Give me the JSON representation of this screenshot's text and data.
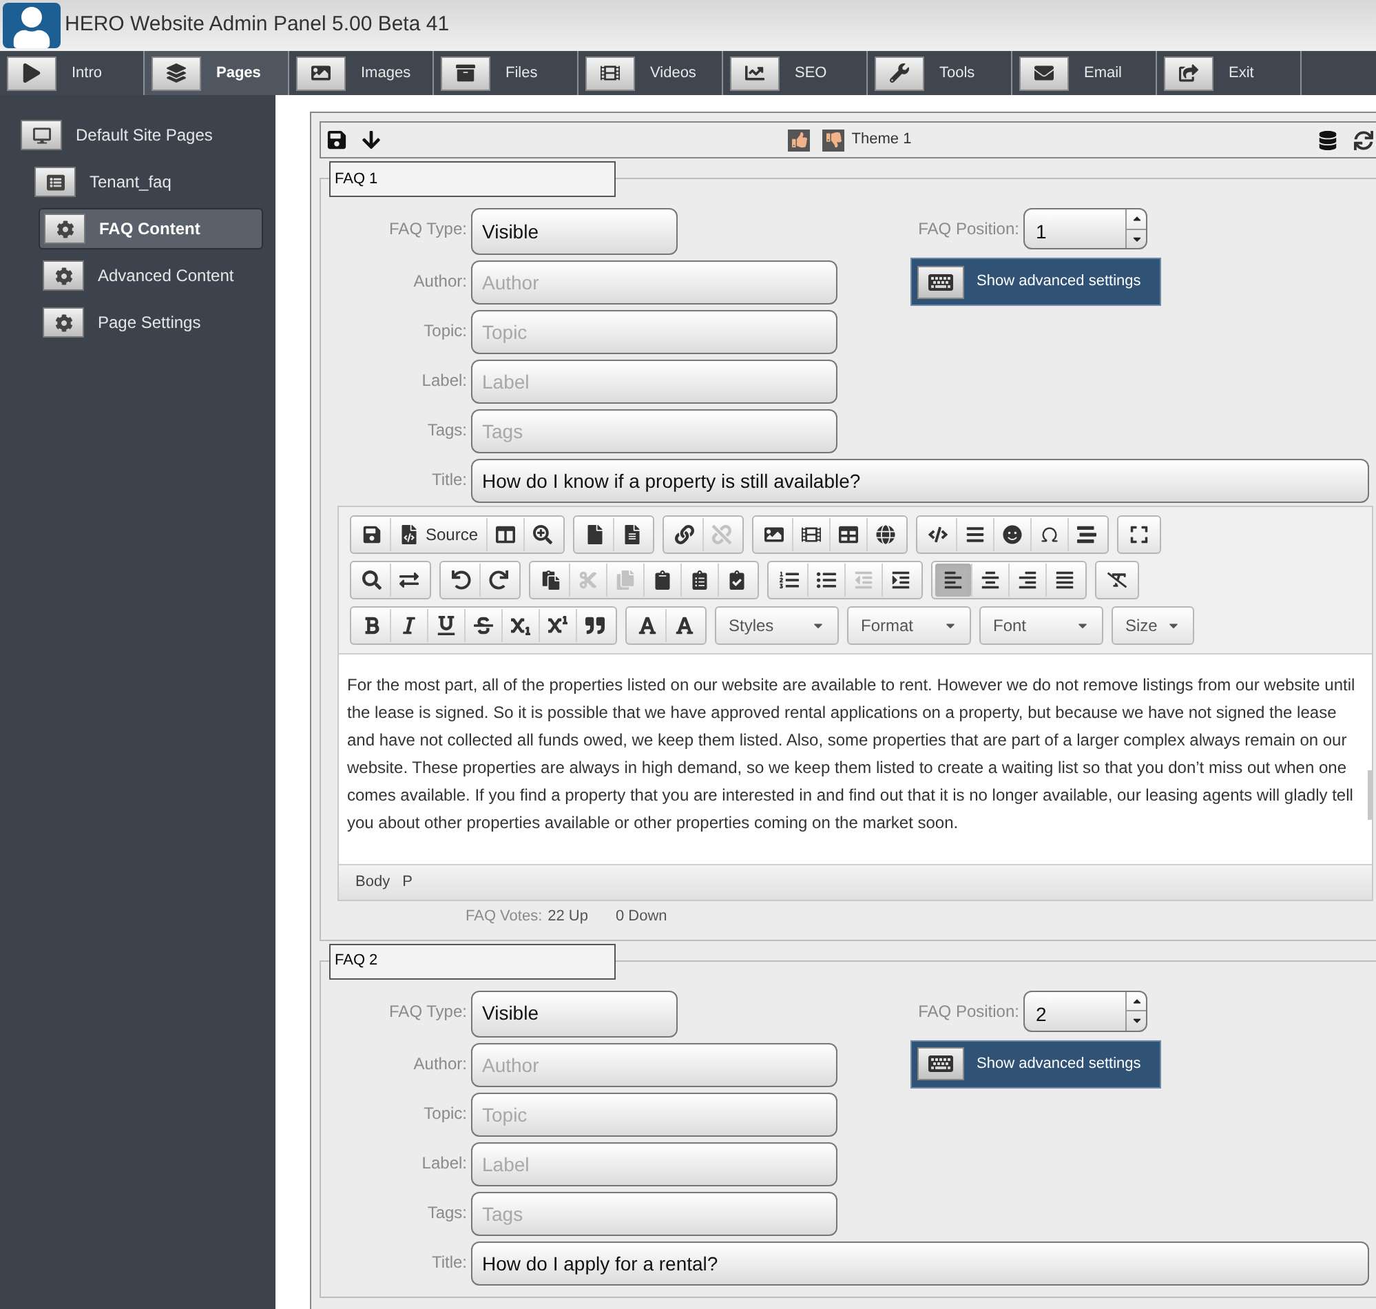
{
  "window": {
    "title": "HERO Website Admin Panel 5.00 Beta 41"
  },
  "nav_tabs": [
    {
      "label": "Intro",
      "selected": false
    },
    {
      "label": "Pages",
      "selected": true
    },
    {
      "label": "Images",
      "selected": false
    },
    {
      "label": "Files",
      "selected": false
    },
    {
      "label": "Videos",
      "selected": false
    },
    {
      "label": "SEO",
      "selected": false
    },
    {
      "label": "Tools",
      "selected": false
    },
    {
      "label": "Email",
      "selected": false
    },
    {
      "label": "Exit",
      "selected": false
    }
  ],
  "sidebar": {
    "items": [
      {
        "label": "Default Site Pages",
        "selected": false,
        "children": [
          {
            "label": "Tenant_faq",
            "selected": false,
            "children": [
              {
                "label": "FAQ Content",
                "selected": true
              },
              {
                "label": "Advanced Content",
                "selected": false
              },
              {
                "label": "Page Settings",
                "selected": false
              }
            ]
          }
        ]
      }
    ]
  },
  "page_toolbar": {
    "theme": "Theme 1"
  },
  "faqs": [
    {
      "legend": "FAQ 1",
      "type_label": "FAQ Type:",
      "type_value": "Visible",
      "position_label": "FAQ Position:",
      "position_value": "1",
      "advanced_button": "Show advanced settings",
      "fields": [
        {
          "label": "Author:",
          "placeholder": "Author"
        },
        {
          "label": "Topic:",
          "placeholder": "Topic"
        },
        {
          "label": "Label:",
          "placeholder": "Label"
        },
        {
          "label": "Tags:",
          "placeholder": "Tags"
        }
      ],
      "title_label": "Title:",
      "title_value": "How do I know if a property is still available?",
      "editor": {
        "toolbar": [
          [
            [
              {
                "disabled": false
              },
              {
                "label": "Source",
                "disabled": false
              },
              {
                "disabled": false
              },
              {
                "disabled": false
              }
            ],
            [
              {
                "disabled": false
              },
              {
                "disabled": false
              }
            ],
            [
              {
                "disabled": false
              },
              {
                "disabled": true
              }
            ],
            [
              {
                "disabled": false
              },
              {
                "disabled": false
              },
              {
                "disabled": false
              },
              {
                "disabled": false
              }
            ],
            [
              {
                "disabled": false
              },
              {
                "disabled": false
              },
              {
                "disabled": false
              },
              {
                "disabled": false
              },
              {
                "disabled": false
              }
            ],
            [
              {
                "disabled": false
              }
            ]
          ],
          [
            [
              {
                "disabled": false
              },
              {
                "disabled": false
              }
            ],
            [
              {
                "disabled": false
              },
              {
                "disabled": false
              }
            ],
            [
              {
                "disabled": false
              },
              {
                "disabled": true
              },
              {
                "disabled": true
              },
              {
                "disabled": false
              },
              {
                "disabled": false
              },
              {
                "disabled": false
              }
            ],
            [
              {
                "disabled": false
              },
              {
                "disabled": false
              },
              {
                "disabled": true
              },
              {
                "disabled": false
              }
            ],
            [
              {
                "disabled": false,
                "selected": true
              },
              {
                "disabled": false,
                "selected": false
              },
              {
                "disabled": false,
                "selected": false
              },
              {
                "disabled": false,
                "selected": false
              }
            ],
            [
              {
                "disabled": false
              }
            ]
          ],
          [
            [
              {
                "disabled": false
              },
              {
                "disabled": false
              },
              {
                "disabled": false
              },
              {
                "disabled": false
              },
              {
                "disabled": false
              },
              {
                "disabled": false
              },
              {
                "disabled": false
              }
            ],
            [
              {
                "disabled": false
              },
              {
                "disabled": false
              }
            ]
          ]
        ],
        "dropdowns": [
          "Styles",
          "Format",
          "Font",
          "Size"
        ],
        "body": "For the most part, all of the properties listed on our website are available to rent. However we do not remove listings from our website until the lease is signed. So it is possible that we have approved rental applications on a property, but because we have not signed the lease and have not collected all funds owed, we keep them listed. Also, some properties that are part of a larger complex always remain on our website. These properties are always in high demand, so we keep them listed to create a waiting list so that you don’t miss out when one comes available. If you find a property that you are interested in and find out that it is no longer available, our leasing agents will gladly tell you about other properties available or other properties coming on the market soon.",
        "path": [
          "Body",
          "P"
        ]
      },
      "votes": {
        "label": "FAQ Votes:",
        "up": "22 Up",
        "down": "0 Down"
      }
    },
    {
      "legend": "FAQ 2",
      "type_label": "FAQ Type:",
      "type_value": "Visible",
      "position_label": "FAQ Position:",
      "position_value": "2",
      "advanced_button": "Show advanced settings",
      "fields": [
        {
          "label": "Author:",
          "placeholder": "Author"
        },
        {
          "label": "Topic:",
          "placeholder": "Topic"
        },
        {
          "label": "Label:",
          "placeholder": "Label"
        },
        {
          "label": "Tags:",
          "placeholder": "Tags"
        }
      ],
      "title_label": "Title:",
      "title_value": "How do I apply for a rental?"
    }
  ]
}
